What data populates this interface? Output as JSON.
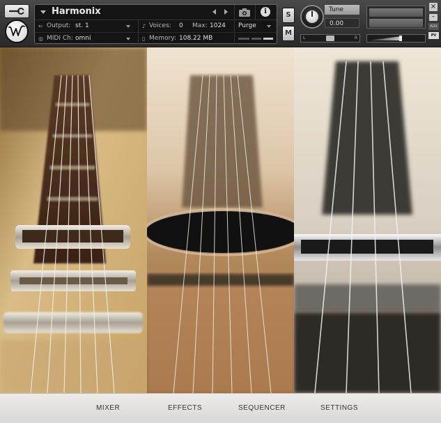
{
  "header": {
    "instrument_name": "Harmonix",
    "output_label": "Output:",
    "output_value": "st. 1",
    "voices_label": "Voices:",
    "voices_value": "0",
    "max_label": "Max:",
    "max_value": "1024",
    "purge_label": "Purge",
    "midi_label": "MIDI Ch:",
    "midi_value": "omni",
    "memory_label": "Memory:",
    "memory_value": "108.22 MB",
    "solo_label": "S",
    "mute_label": "M",
    "tune_label": "Tune",
    "tune_value": "0.00",
    "pan_left": "L",
    "pan_right": "R",
    "aux_label": "AUX",
    "pv_label": "PV",
    "close_label": "×",
    "minimize_label": "–",
    "logo_letter": "W"
  },
  "nav": {
    "tabs": [
      "MIXER",
      "EFFECTS",
      "SEQUENCER",
      "SETTINGS"
    ]
  },
  "colors": {
    "panel_bg": "#141414",
    "nav_bg": "#e4e2df"
  }
}
